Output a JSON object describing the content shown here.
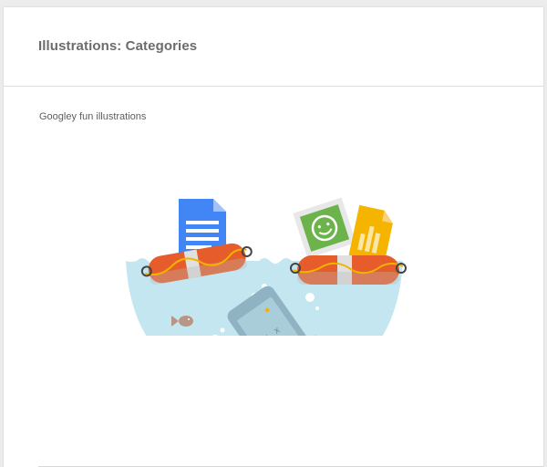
{
  "card": {
    "title": "Illustrations: Categories",
    "subtitle": "Googley fun illustrations"
  },
  "illustration": {
    "subject": "rescue-floats-water-bowl",
    "colors": {
      "water": "#c3e6f0",
      "float": "#e65c2a",
      "float_band": "#e0e0e0",
      "rope": "#f2b400",
      "doc_blue": "#4285f4",
      "photo_green": "#6bb34a",
      "chart_yellow": "#f4b400",
      "phone": "#8fb3c2"
    }
  }
}
